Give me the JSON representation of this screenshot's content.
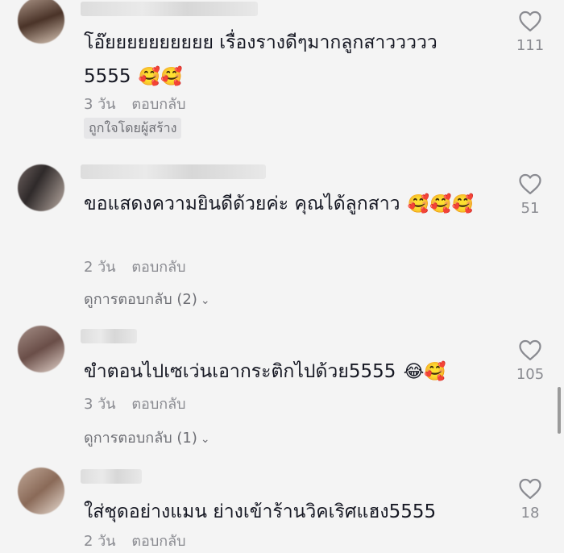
{
  "comments": [
    {
      "text": "โอ๊ยยยยยยยยยย เรื่องรางดีๆมากลูกสาววววว 5555",
      "emoji": "🥰🥰",
      "time": "3 วัน",
      "reply": "ตอบกลับ",
      "badge": "ถูกใจโดยผู้สร้าง",
      "likes": "111"
    },
    {
      "text": "ขอแสดงความยินดีด้วยค่ะ คุณได้ลูกสาว",
      "emoji": "🥰🥰🥰",
      "time": "2 วัน",
      "reply": "ตอบกลับ",
      "view_replies": "ดูการตอบกลับ (2)",
      "likes": "51"
    },
    {
      "text": "ขำตอนไปเซเว่นเอากระติกไปด้วย5555",
      "emoji": "😂🥰",
      "time": "3 วัน",
      "reply": "ตอบกลับ",
      "view_replies": "ดูการตอบกลับ (1)",
      "likes": "105"
    },
    {
      "text": "ใส่ชุดอย่างแมน ย่างเข้าร้านวิคเริศแฮง5555",
      "emoji": "",
      "time": "2 วัน",
      "reply": "ตอบกลับ",
      "likes": "18"
    }
  ],
  "icons": {
    "like": "heart-outline-icon",
    "expand": "chevron-down-icon"
  },
  "colors": {
    "background": "#f4f4f4",
    "text": "#161823",
    "muted": "#8a8b91"
  }
}
